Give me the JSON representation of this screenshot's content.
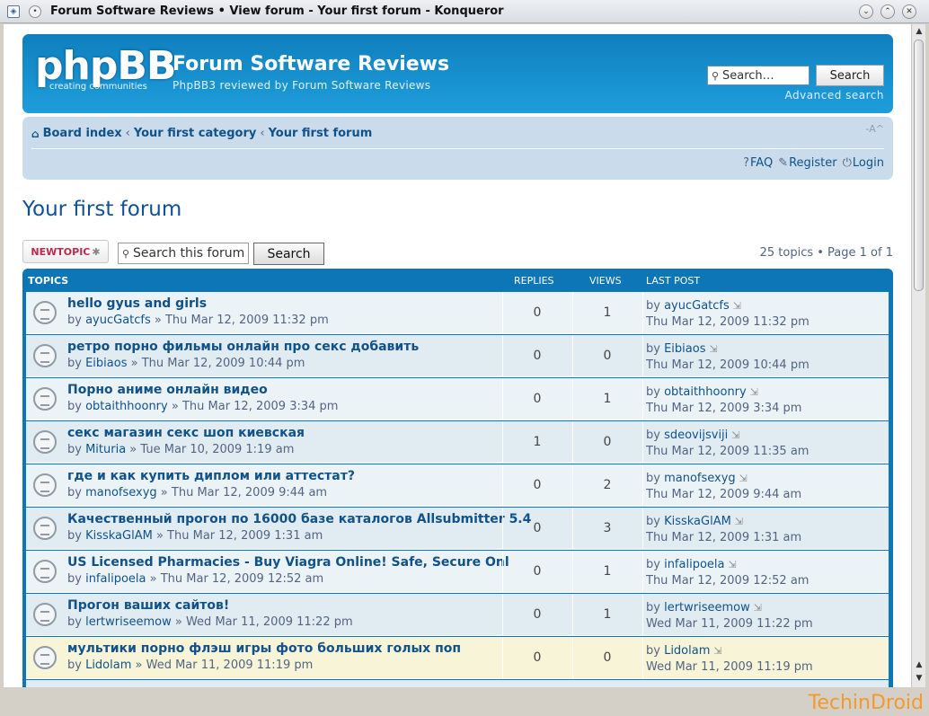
{
  "window": {
    "title": "Forum Software Reviews • View forum - Your first forum - Konqueror"
  },
  "header": {
    "logo_text": "phpBB",
    "logo_sub": "creating   communities",
    "site_title": "Forum Software Reviews",
    "site_desc": "PhpBB3 reviewed by Forum Software Reviews",
    "search_placeholder": "Search…",
    "search_button": "Search",
    "advanced_search": "Advanced search"
  },
  "nav": {
    "breadcrumbs": [
      "Board index",
      "Your first category",
      "Your first forum"
    ],
    "font_size": "-A^",
    "links": {
      "faq": "FAQ",
      "register": "Register",
      "login": "Login"
    }
  },
  "forum": {
    "title": "Your first forum",
    "new_topic": "NEWTOPIC",
    "search_value": "Search this forum…",
    "search_button": "Search",
    "pagination": "25 topics • Page 1 of 1"
  },
  "table": {
    "headers": {
      "topics": "TOPICS",
      "replies": "REPLIES",
      "views": "VIEWS",
      "last_post": "LAST POST"
    },
    "rows": [
      {
        "title": "hello gyus and girls",
        "author": "ayucGatcfs",
        "date": "Thu Mar 12, 2009 11:32 pm",
        "replies": "0",
        "views": "1",
        "lp_author": "ayucGatcfs",
        "lp_date": "Thu Mar 12, 2009 11:32 pm"
      },
      {
        "title": "ретро порно фильмы онлайн про секс добавить",
        "author": "Eibiaos",
        "date": "Thu Mar 12, 2009 10:44 pm",
        "replies": "0",
        "views": "0",
        "lp_author": "Eibiaos",
        "lp_date": "Thu Mar 12, 2009 10:44 pm"
      },
      {
        "title": "Порно аниме онлайн видео",
        "author": "obtaithhoonry",
        "date": "Thu Mar 12, 2009 3:34 pm",
        "replies": "0",
        "views": "1",
        "lp_author": "obtaithhoonry",
        "lp_date": "Thu Mar 12, 2009 3:34 pm"
      },
      {
        "title": "секс магазин секс шоп киевская",
        "author": "Mituria",
        "date": "Tue Mar 10, 2009 1:19 am",
        "replies": "1",
        "views": "0",
        "lp_author": "sdeovijsviji",
        "lp_date": "Thu Mar 12, 2009 11:35 am"
      },
      {
        "title": "где и как купить диплом или аттестат?",
        "author": "manofsexyg",
        "date": "Thu Mar 12, 2009 9:44 am",
        "replies": "0",
        "views": "2",
        "lp_author": "manofsexyg",
        "lp_date": "Thu Mar 12, 2009 9:44 am"
      },
      {
        "title": "Качественный прогон по 16000 базе каталогов Allsubmitter 5.4",
        "author": "KisskaGlAM",
        "date": "Thu Mar 12, 2009 1:31 am",
        "replies": "0",
        "views": "3",
        "lp_author": "KisskaGlAM",
        "lp_date": "Thu Mar 12, 2009 1:31 am"
      },
      {
        "title": "US Licensed Pharmacies - Buy Viagra Online! Safe, Secure Onl",
        "author": "infalipoela",
        "date": "Thu Mar 12, 2009 12:52 am",
        "replies": "0",
        "views": "1",
        "lp_author": "infalipoela",
        "lp_date": "Thu Mar 12, 2009 12:52 am"
      },
      {
        "title": "Прогон ваших сайтов!",
        "author": "lertwriseemow",
        "date": "Wed Mar 11, 2009 11:22 pm",
        "replies": "0",
        "views": "1",
        "lp_author": "lertwriseemow",
        "lp_date": "Wed Mar 11, 2009 11:22 pm"
      },
      {
        "title": "мультики порно флэш игры фото больших голых поп",
        "author": "Lidolam",
        "date": "Wed Mar 11, 2009 11:19 pm",
        "replies": "0",
        "views": "0",
        "lp_author": "Lidolam",
        "lp_date": "Wed Mar 11, 2009 11:19 pm"
      }
    ]
  },
  "watermark": "TechinDroid"
}
